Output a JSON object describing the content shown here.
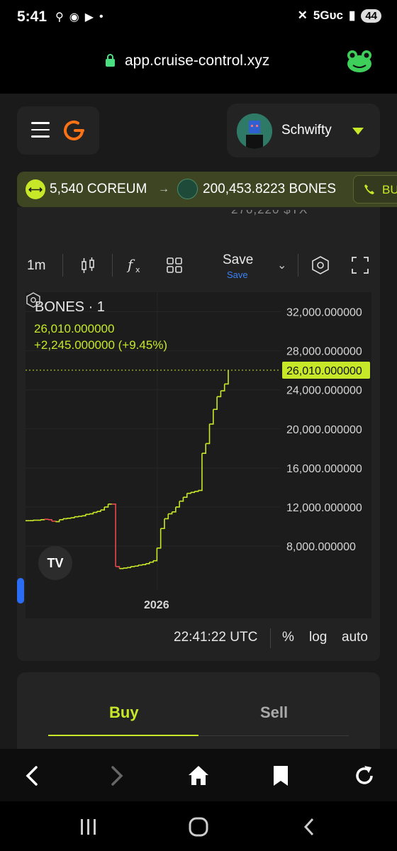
{
  "status": {
    "time": "5:41",
    "network": "5Gᴜᴄ",
    "battery": "44"
  },
  "browser": {
    "url": "app.cruise-control.xyz"
  },
  "header": {
    "user_name": "Schwifty"
  },
  "swap": {
    "from_amount": "5,540 COREUM",
    "arrow": "→",
    "to_amount": "200,453.8223 BONES",
    "action_label": "BU"
  },
  "chart_card": {
    "cut_text": "276,220 $TX",
    "toolbar": {
      "interval": "1m",
      "save_label": "Save",
      "save_sub": "Save"
    },
    "footer": {
      "time": "22:41:22 UTC",
      "percent": "%",
      "log": "log",
      "auto": "auto"
    }
  },
  "chart_data": {
    "type": "line",
    "title": "BONES · 1",
    "price_label": "26,010.000000",
    "change_label": "+2,245.000000 (+9.45%)",
    "y_ticks": [
      "32,000.000000",
      "28,000.000000",
      "24,000.000000",
      "20,000.000000",
      "16,000.000000",
      "12,000.000000",
      "8,000.000000"
    ],
    "y_tick_values": [
      32000,
      28000,
      24000,
      20000,
      16000,
      12000,
      8000
    ],
    "ylim": [
      3500,
      34000
    ],
    "x_tick": "2026",
    "last_price": 26010,
    "series": [
      {
        "values": [
          10600,
          10600,
          10650,
          10650,
          10700,
          10750,
          10700,
          10550,
          10500,
          10700,
          10800,
          10850,
          10900,
          11000,
          11050,
          11100,
          11250,
          11300,
          11450,
          11550,
          11700,
          12000,
          12300,
          12300,
          5900,
          5700,
          5750,
          5800,
          5900,
          5950,
          6050,
          6100,
          6200,
          6350,
          6500,
          7800,
          9800,
          10800,
          11300,
          11500,
          12000,
          12600,
          13000,
          13400,
          13500,
          13600,
          13700,
          17500,
          18500,
          20500,
          22000,
          23300,
          23900,
          24600,
          26010
        ]
      }
    ],
    "grid": true,
    "colors": {
      "up": "#c6e829",
      "down": "#e5484d",
      "price_tag": "#c6e829"
    }
  },
  "trade": {
    "tab_buy": "Buy",
    "tab_sell": "Sell"
  }
}
